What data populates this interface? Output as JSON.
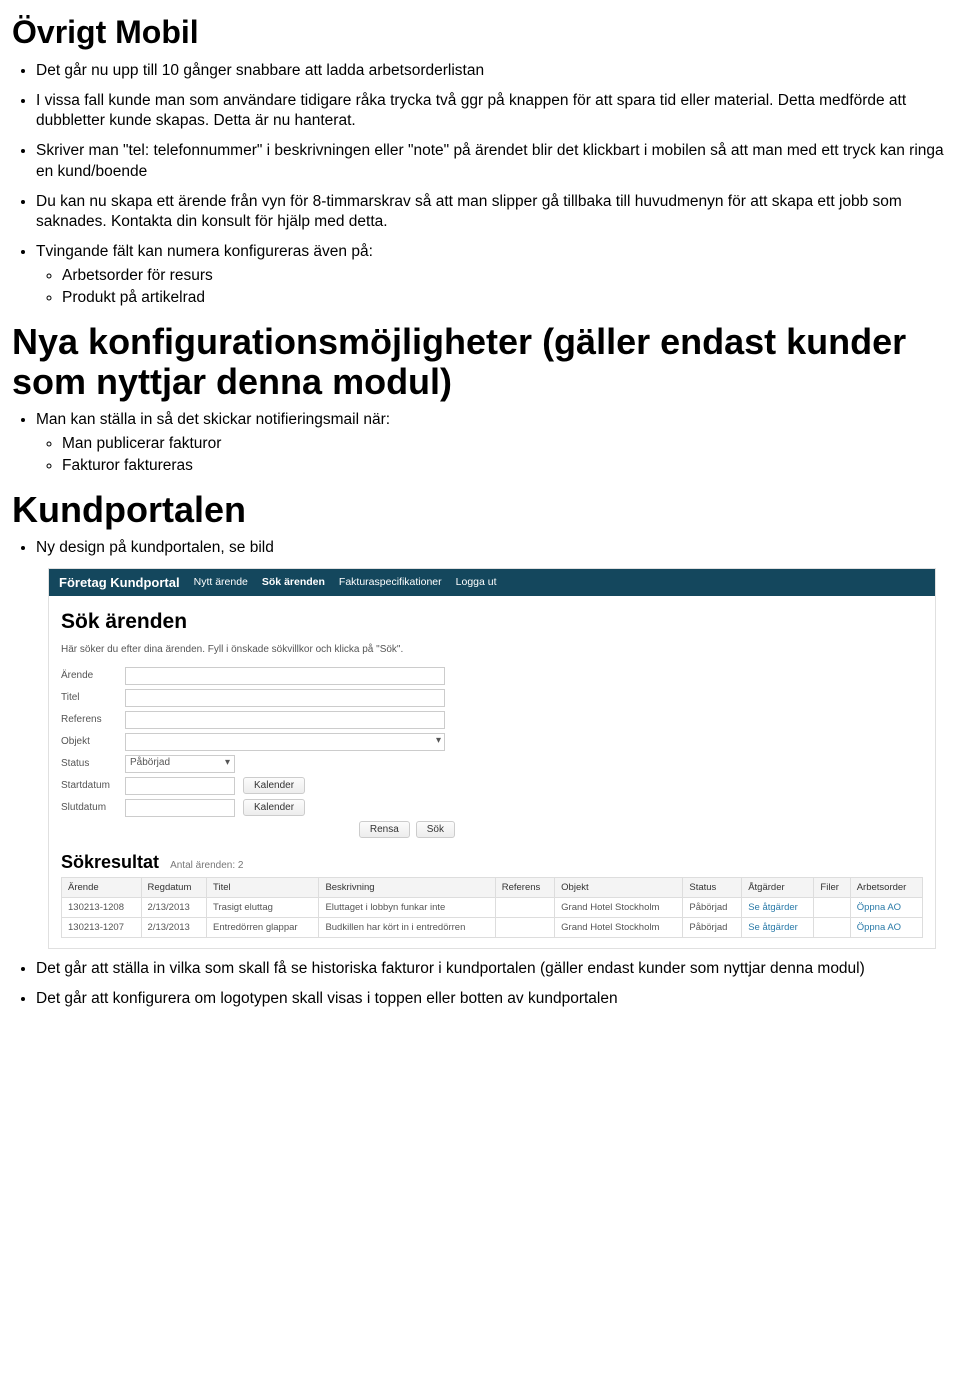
{
  "h1_1": "Övrigt Mobil",
  "list1": [
    "Det går nu upp till 10 gånger snabbare att ladda arbetsorderlistan",
    "I vissa fall kunde man som användare tidigare råka trycka två ggr på knappen för att spara tid eller material. Detta medförde att dubbletter kunde skapas. Detta är nu hanterat.",
    "Skriver man \"tel: telefonnummer\" i beskrivningen eller \"note\" på ärendet blir det klickbart i mobilen så att man med ett tryck kan ringa en kund/boende",
    "Du kan nu skapa ett ärende från vyn för 8-timmarskrav så att man slipper gå tillbaka till huvudmenyn för att skapa ett jobb som saknades. Kontakta din konsult för hjälp med detta.",
    "Tvingande fält kan numera konfigureras även på:"
  ],
  "sub1": [
    "Arbetsorder för resurs",
    "Produkt på artikelrad"
  ],
  "h1_2": "Nya konfigurationsmöjligheter (gäller endast kunder som nyttjar denna modul)",
  "list2_item": "Man kan ställa in så det skickar notifieringsmail när:",
  "sub2": [
    "Man publicerar fakturor",
    "Fakturor faktureras"
  ],
  "h1_3": "Kundportalen",
  "list3_first": "Ny design på kundportalen, se bild",
  "list3_after": [
    "Det går att ställa in vilka som skall få se historiska fakturor i kundportalen (gäller endast kunder som nyttjar denna modul)",
    "Det går att konfigurera om logotypen skall visas i toppen eller botten av kundportalen"
  ],
  "portal": {
    "brand": "Företag Kundportal",
    "nav": [
      "Nytt ärende",
      "Sök ärenden",
      "Fakturaspecifikationer",
      "Logga ut"
    ],
    "page_title": "Sök ärenden",
    "hint": "Här söker du efter dina ärenden. Fyll i önskade sökvillkor och klicka på \"Sök\".",
    "labels": {
      "arende": "Ärende",
      "titel": "Titel",
      "referens": "Referens",
      "objekt": "Objekt",
      "status": "Status",
      "startdatum": "Startdatum",
      "slutdatum": "Slutdatum",
      "kalender": "Kalender"
    },
    "status_value": "Påbörjad",
    "btn_rensa": "Rensa",
    "btn_sok": "Sök",
    "result_title": "Sökresultat",
    "result_count_label": "Antal ärenden: 2",
    "columns": [
      "Ärende",
      "Regdatum",
      "Titel",
      "Beskrivning",
      "Referens",
      "Objekt",
      "Status",
      "Åtgärder",
      "Filer",
      "Arbetsorder"
    ],
    "rows": [
      {
        "arende": "130213-1208",
        "regdatum": "2/13/2013",
        "titel": "Trasigt eluttag",
        "beskr": "Eluttaget i lobbyn funkar inte",
        "ref": "",
        "objekt": "Grand Hotel Stockholm",
        "status": "Påbörjad",
        "atg": "Se åtgärder",
        "filer": "",
        "ao": "Öppna AO"
      },
      {
        "arende": "130213-1207",
        "regdatum": "2/13/2013",
        "titel": "Entredörren glappar",
        "beskr": "Budkillen har kört in i entredörren",
        "ref": "",
        "objekt": "Grand Hotel Stockholm",
        "status": "Påbörjad",
        "atg": "Se åtgärder",
        "filer": "",
        "ao": "Öppna AO"
      }
    ]
  }
}
